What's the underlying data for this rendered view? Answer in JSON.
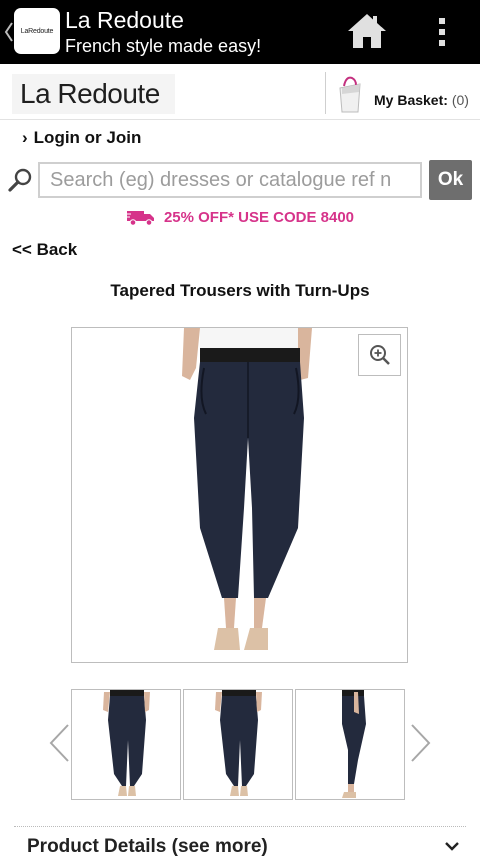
{
  "app_bar": {
    "logo_text": "LaRedoute",
    "title": "La Redoute",
    "subtitle": "French style made easy!"
  },
  "header": {
    "brand": "La Redoute",
    "basket_label": "My Basket:",
    "basket_count": "(0)"
  },
  "account": {
    "login_chevron": "›",
    "login_label": "Login or Join"
  },
  "search": {
    "placeholder": "Search (eg) dresses or catalogue ref n",
    "button_label": "Ok"
  },
  "promo": {
    "text": "25% OFF* USE CODE 8400",
    "color": "#d6338a"
  },
  "nav": {
    "back_label": "<< Back"
  },
  "product": {
    "title": "Tapered Trousers with Turn-Ups",
    "details_label": "Product Details (see more)",
    "trouser_color": "#232a3d"
  },
  "icons": [
    "back-arrow-icon",
    "home-icon",
    "overflow-menu-icon",
    "basket-icon",
    "search-icon",
    "truck-icon",
    "zoom-in-icon",
    "chevron-left-icon",
    "chevron-right-icon",
    "chevron-down-icon"
  ]
}
